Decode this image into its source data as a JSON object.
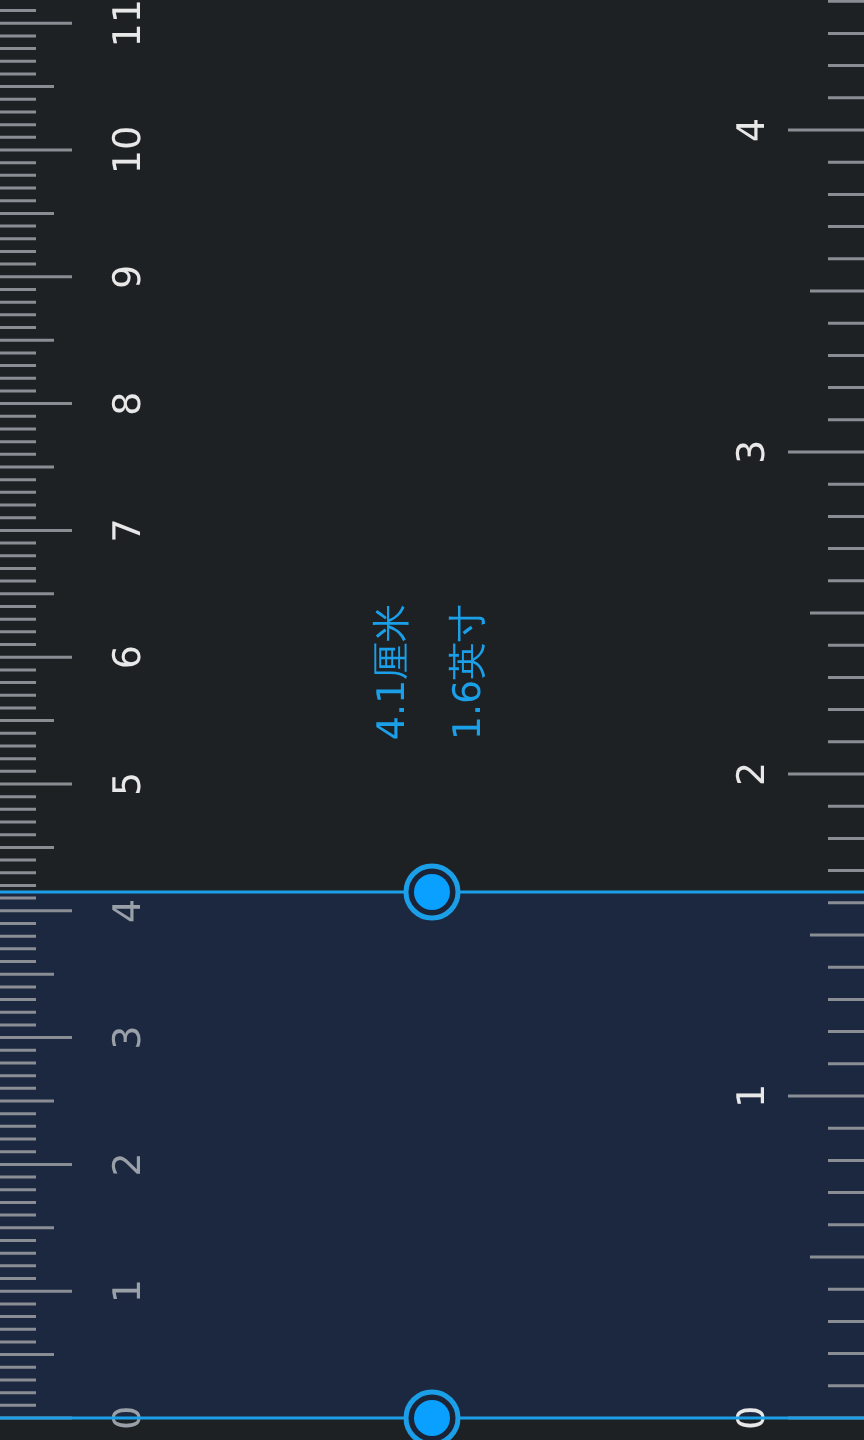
{
  "ruler": {
    "cm_labels": [
      "0",
      "1",
      "2",
      "3",
      "4",
      "5",
      "6",
      "7",
      "8",
      "9",
      "10",
      "11"
    ],
    "inch_labels": [
      "0",
      "1",
      "2",
      "3",
      "4"
    ]
  },
  "measurement": {
    "cm_reading": "4.1厘米",
    "inch_reading": "1.6英寸"
  }
}
